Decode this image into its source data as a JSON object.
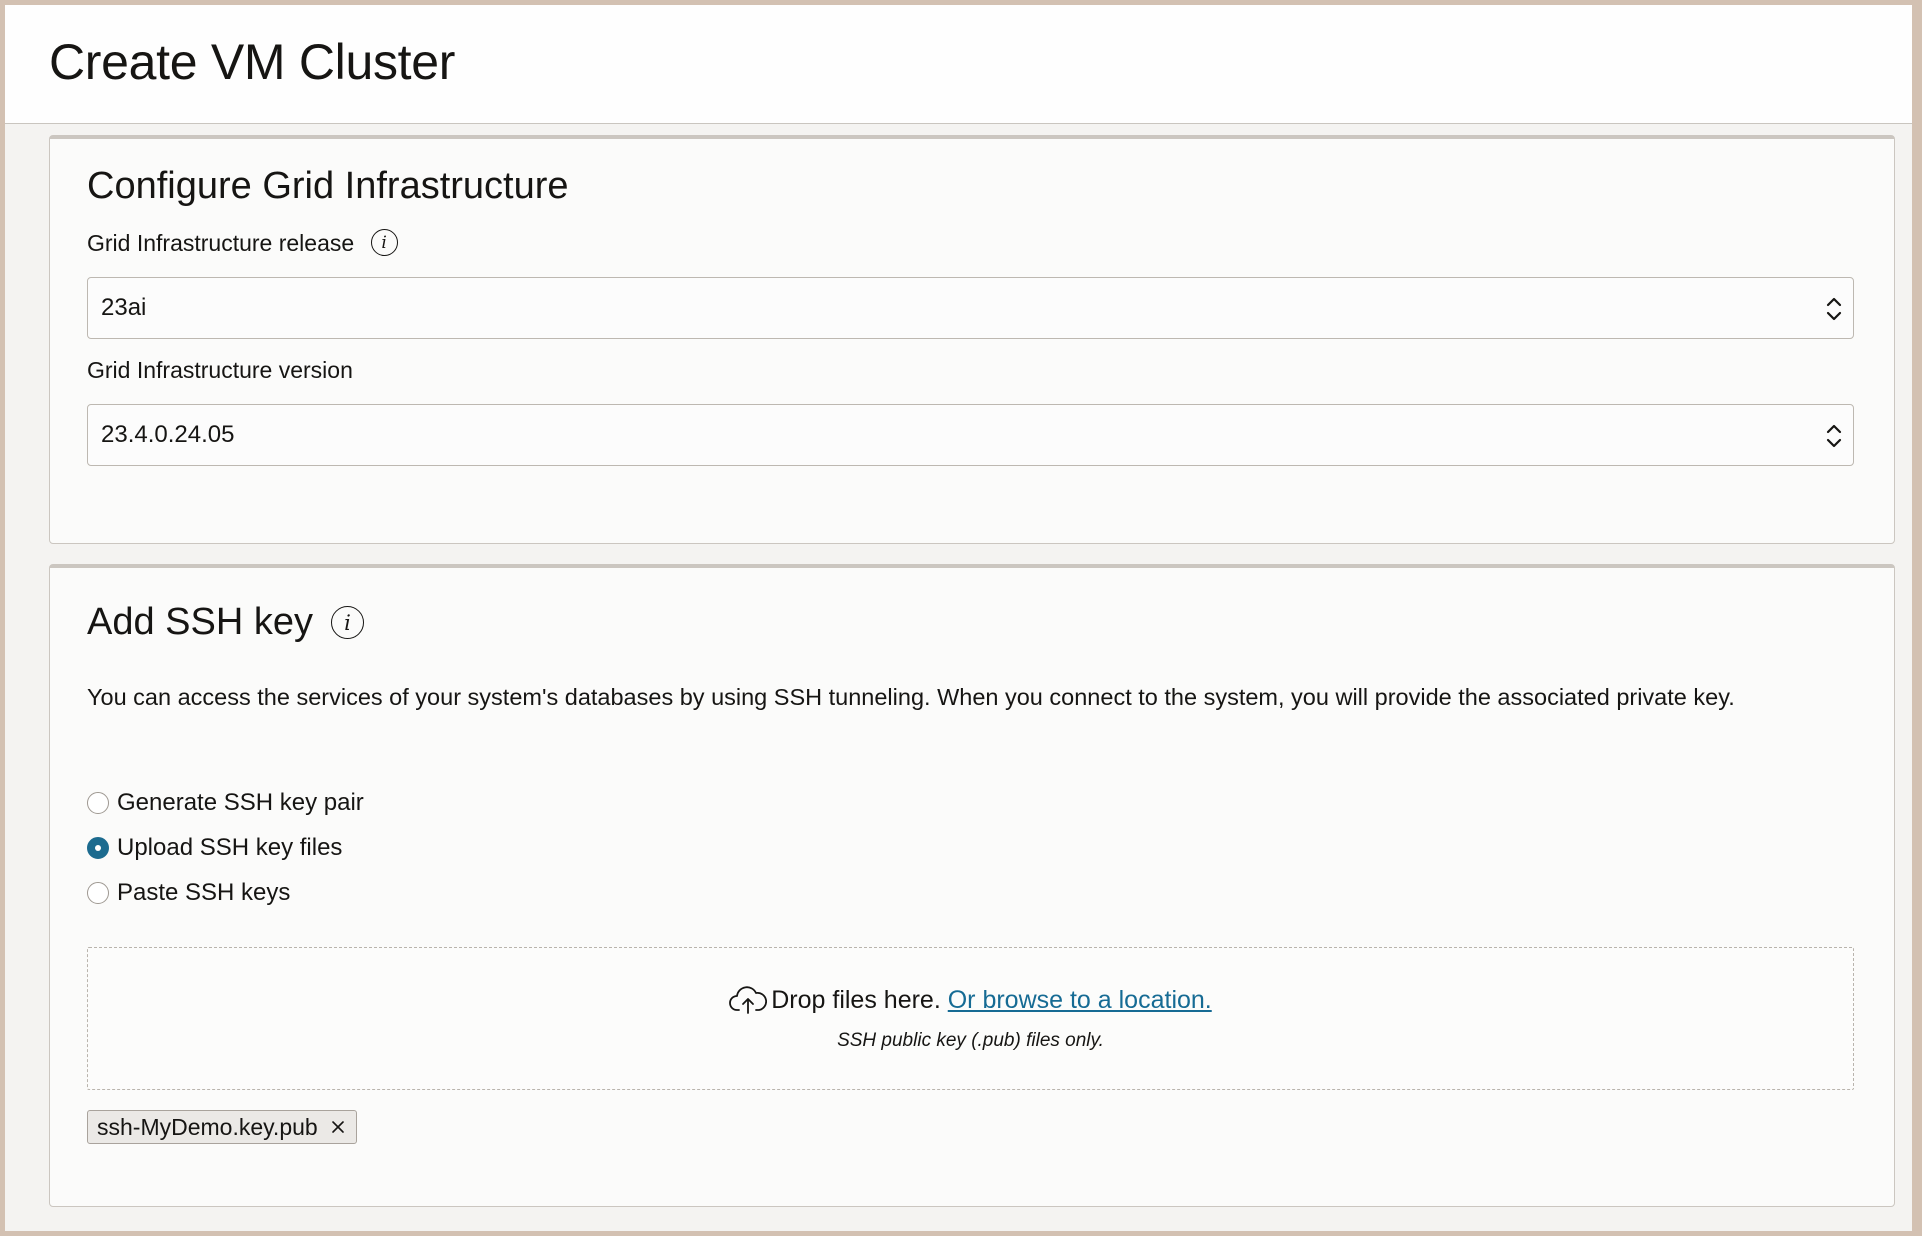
{
  "page": {
    "title": "Create VM Cluster"
  },
  "grid": {
    "title": "Configure Grid Infrastructure",
    "release_label": "Grid Infrastructure release",
    "release_value": "23ai",
    "version_label": "Grid Infrastructure version",
    "version_value": "23.4.0.24.05"
  },
  "ssh": {
    "title": "Add SSH key",
    "description": "You can access the services of your system's databases by using SSH tunneling. When you connect to the system, you will provide the associated private key.",
    "options": [
      {
        "label": "Generate SSH key pair",
        "selected": false
      },
      {
        "label": "Upload SSH key files",
        "selected": true
      },
      {
        "label": "Paste SSH keys",
        "selected": false
      }
    ],
    "dropzone": {
      "text": "Drop files here.",
      "link": "Or browse to a location.",
      "hint": "SSH public key (.pub) files only."
    },
    "files": [
      "ssh-MyDemo.key.pub"
    ]
  },
  "colors": {
    "accent": "#1c6b8f",
    "link": "#166b94",
    "frame": "#d3c1b2"
  },
  "icons": {
    "info": "info-icon",
    "select_caret": "chevron-up-down-icon",
    "upload": "cloud-upload-icon",
    "remove": "close-icon"
  }
}
